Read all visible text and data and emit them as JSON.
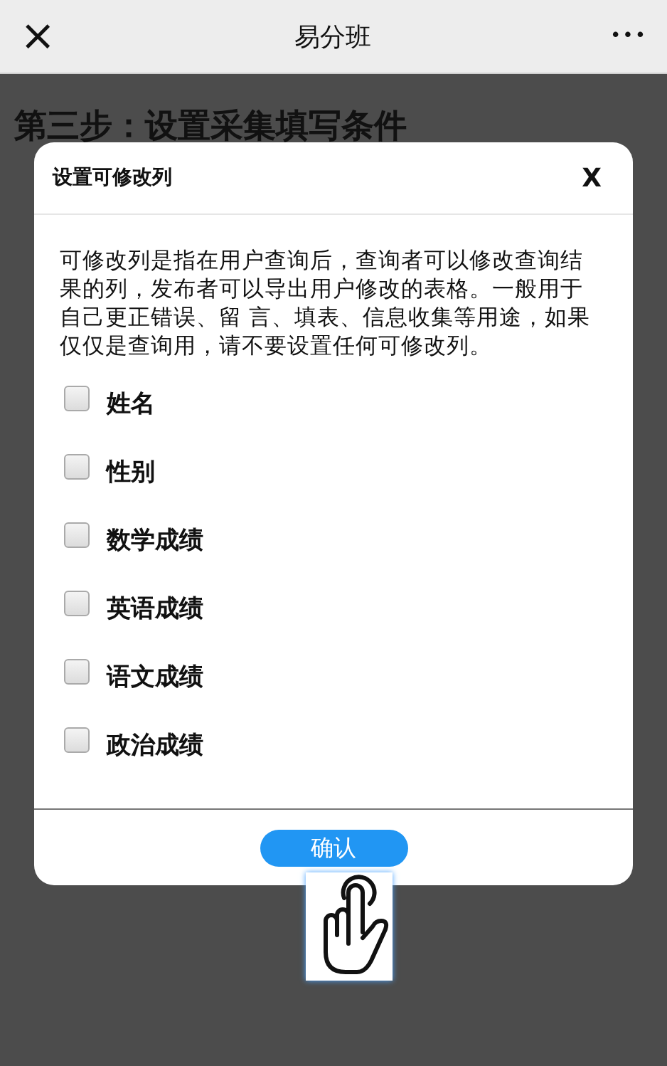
{
  "nav_bar": {
    "close_icon": "×",
    "title": "易分班",
    "more_icon": "•••"
  },
  "page": {
    "heading": "第三步：设置采集填写条件"
  },
  "dialog": {
    "title": "设置可修改列",
    "close": "X",
    "description": "可修改列是指在用户查询后，查询者可以修改查询结果的列，发布者可以导出用户修改的表格。一般用于自己更正错误、留 言、填表、信息收集等用途，如果仅仅是查询用，请不要设置任何可修改列。",
    "columns": [
      {
        "label": "姓名",
        "checked": false
      },
      {
        "label": "性别",
        "checked": false
      },
      {
        "label": "数学成绩",
        "checked": false
      },
      {
        "label": "英语成绩",
        "checked": false
      },
      {
        "label": "语文成绩",
        "checked": false
      },
      {
        "label": "政治成绩",
        "checked": false
      }
    ],
    "confirm": "确认"
  }
}
